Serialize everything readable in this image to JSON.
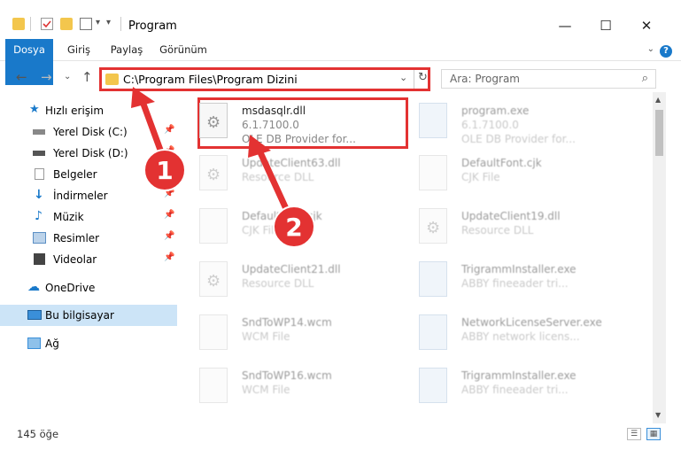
{
  "window": {
    "title": "Program",
    "minimize": "—",
    "maximize": "☐",
    "close": "✕"
  },
  "ribbon": {
    "tabs": [
      "Dosya",
      "Giriş",
      "Paylaş",
      "Görünüm"
    ],
    "help": "?"
  },
  "nav": {
    "back": "←",
    "forward": "→",
    "recent": "⌄",
    "up": "↑",
    "address_path": "C:\\Program Files\\Program Dizini",
    "dropdown": "⌄",
    "refresh": "↻",
    "search_placeholder": "Ara: Program",
    "search_icon": "⌕"
  },
  "sidebar": {
    "items": [
      {
        "label": "Hızlı erişim",
        "icon": "star-icon",
        "color": "#1979ca",
        "pinned": false
      },
      {
        "label": "Yerel Disk (C:)",
        "icon": "drive-icon",
        "color": "#777777",
        "pinned": true
      },
      {
        "label": "Yerel Disk (D:)",
        "icon": "drive-icon",
        "color": "#777777",
        "pinned": true
      },
      {
        "label": "Belgeler",
        "icon": "document-icon",
        "color": "#aaaaaa",
        "pinned": true
      },
      {
        "label": "İndirmeler",
        "icon": "download-icon",
        "color": "#1979ca",
        "pinned": true
      },
      {
        "label": "Müzik",
        "icon": "music-icon",
        "color": "#1979ca",
        "pinned": true
      },
      {
        "label": "Resimler",
        "icon": "picture-icon",
        "color": "#5b8fc4",
        "pinned": true
      },
      {
        "label": "Videolar",
        "icon": "film-icon",
        "color": "#444444",
        "pinned": true
      },
      {
        "label": "OneDrive",
        "icon": "cloud-icon",
        "color": "#1979ca",
        "pinned": false
      },
      {
        "label": "Bu bilgisayar",
        "icon": "computer-icon",
        "color": "#3a8fd9",
        "pinned": false,
        "selected": true
      },
      {
        "label": "Ağ",
        "icon": "network-icon",
        "color": "#3a8fd9",
        "pinned": false
      }
    ],
    "pin_glyph": "📌"
  },
  "files": {
    "left": [
      {
        "name": "msdasqlr.dll",
        "sub1": "6.1.7100.0",
        "sub2": "OLE DB Provider for...",
        "kind": "dll"
      },
      {
        "name": "UpdateClient63.dll",
        "sub1": "Resource DLL",
        "kind": "dll"
      },
      {
        "name": "DefaultFont.cjk",
        "sub1": "CJK File",
        "kind": "doc"
      },
      {
        "name": "UpdateClient21.dll",
        "sub1": "Resource DLL",
        "kind": "dll"
      },
      {
        "name": "SndToWP14.wcm",
        "sub1": "WCM File",
        "kind": "doc"
      },
      {
        "name": "SndToWP16.wcm",
        "sub1": "WCM File",
        "kind": "doc"
      }
    ],
    "right": [
      {
        "name": "program.exe",
        "sub1": "6.1.7100.0",
        "sub2": "OLE DB Provider for...",
        "kind": "exe"
      },
      {
        "name": "DefaultFont.cjk",
        "sub1": "CJK File",
        "kind": "doc"
      },
      {
        "name": "UpdateClient19.dll",
        "sub1": "Resource DLL",
        "kind": "dll"
      },
      {
        "name": "TrigrammInstaller.exe",
        "sub1": "ABBY fineeader tri...",
        "kind": "exe"
      },
      {
        "name": "NetworkLicenseServer.exe",
        "sub1": "ABBY network licens...",
        "kind": "exe"
      },
      {
        "name": "TrigrammInstaller.exe",
        "sub1": "ABBY fineeader tri...",
        "kind": "exe"
      }
    ]
  },
  "annotations": [
    "1",
    "2"
  ],
  "status": {
    "count": "145 öğe",
    "details_view": "☰",
    "icons_view": "▦"
  },
  "colors": {
    "accent": "#1979ca",
    "highlight": "#e33232",
    "selected_bg": "#cce4f7"
  }
}
